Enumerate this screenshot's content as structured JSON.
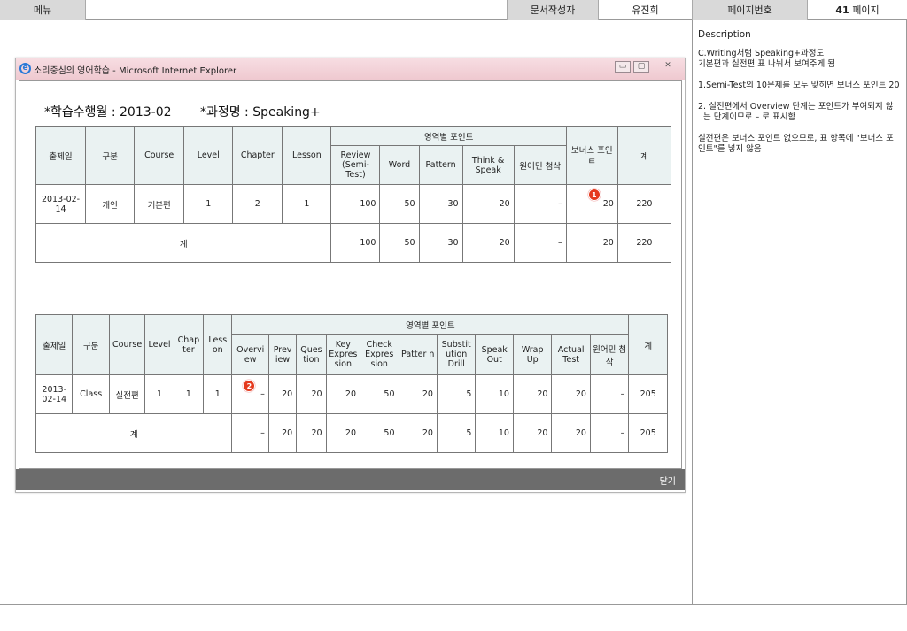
{
  "header": {
    "menu": "메뉴",
    "author_label": "문서작성자",
    "author": "유진희",
    "page_label": "페이지번호",
    "page_num": "41",
    "page_unit": "페이지"
  },
  "description": {
    "title": "Description",
    "paragraphs": [
      "C.Writing처럼 Speaking+과정도\n기본편과 실전편  표 나눠서 보여주게 됨",
      "1.Semi-Test의 10문제를 모두 맞히면 보너스 포인트 20",
      "2. 실전편에서 Overview 단계는 포인트가 부여되지 않는 단계이므로 – 로 표시함",
      "실전편은 보너스 포인트 없으므로, 표 항목에 \"보너스 포인트\"를 넣지 않음"
    ]
  },
  "window": {
    "title": "소리중심의 영어학습 - Microsoft Internet Explorer",
    "minimize": "▭",
    "maximize": "▢",
    "close": "✕",
    "close_button": "닫기"
  },
  "heading": {
    "month": "*학습수행월 : 2013-02",
    "course": "*과정명 : Speaking+"
  },
  "table1": {
    "headers": {
      "date": "출제일",
      "type": "구분",
      "course": "Course",
      "level": "Level",
      "chapter": "Chapter",
      "lesson": "Lesson",
      "area": "영역별 포인트",
      "bonus": "보너스 포인트",
      "total": "계",
      "review": "Review (Semi-Test)",
      "word": "Word",
      "pattern": "Pattern",
      "think": "Think & Speak",
      "native": "원어민 첨삭"
    },
    "row": {
      "date": "2013-02-14",
      "type": "개인",
      "course": "기본편",
      "level": "1",
      "chapter": "2",
      "lesson": "1",
      "review": "100",
      "word": "50",
      "pattern": "30",
      "think": "20",
      "native": "–",
      "bonus": "20",
      "total": "220"
    },
    "sum": {
      "label": "계",
      "review": "100",
      "word": "50",
      "pattern": "30",
      "think": "20",
      "native": "–",
      "bonus": "20",
      "total": "220"
    },
    "badge": "1"
  },
  "table2": {
    "headers": {
      "date": "출제일",
      "type": "구분",
      "course": "Course",
      "level": "Level",
      "chapter": "Chap ter",
      "lesson": "Less on",
      "area": "영역별 포인트",
      "total": "계",
      "overview": "Overvi ew",
      "preview": "Prev iew",
      "question": "Ques tion",
      "key": "Key Expres sion",
      "check": "Check Expres sion",
      "pattern": "Patter n",
      "subst": "Substit ution Drill",
      "speak": "Speak Out",
      "wrap": "Wrap Up",
      "actual": "Actual Test",
      "native": "원어민 첨삭"
    },
    "row": {
      "date": "2013-02-14",
      "type": "Class",
      "course": "실전편",
      "level": "1",
      "chapter": "1",
      "lesson": "1",
      "overview": "–",
      "preview": "20",
      "question": "20",
      "key": "20",
      "check": "50",
      "pattern": "20",
      "subst": "5",
      "speak": "10",
      "wrap": "20",
      "actual": "20",
      "native": "–",
      "total": "205"
    },
    "sum": {
      "label": "계",
      "overview": "–",
      "preview": "20",
      "question": "20",
      "key": "20",
      "check": "50",
      "pattern": "20",
      "subst": "5",
      "speak": "10",
      "wrap": "20",
      "actual": "20",
      "native": "–",
      "total": "205"
    },
    "badge": "2"
  }
}
